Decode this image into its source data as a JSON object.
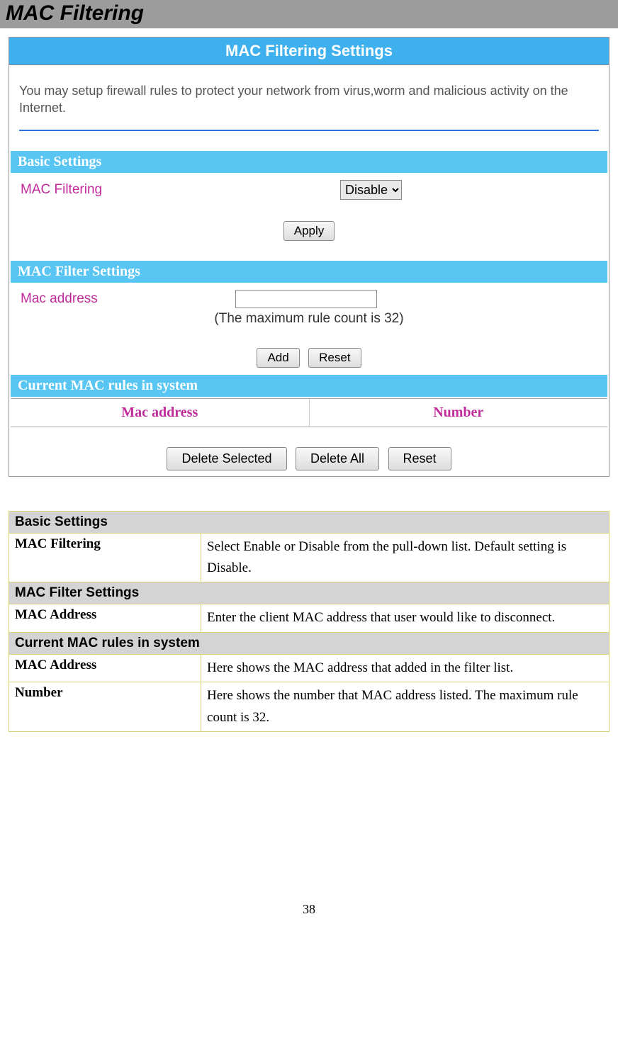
{
  "pageTitle": "MAC Filtering",
  "panel": {
    "headerTitle": "MAC Filtering Settings",
    "intro": "You may setup firewall rules to protect your network from virus,worm and malicious activity on the Internet.",
    "basicSection": {
      "title": "Basic Settings",
      "macFilteringLabel": "MAC Filtering",
      "selectValue": "Disable",
      "applyLabel": "Apply"
    },
    "filterSection": {
      "title": "MAC Filter Settings",
      "macAddressLabel": "Mac address",
      "macAddressValue": "",
      "note": "(The maximum rule count is 32)",
      "addLabel": "Add",
      "resetLabel": "Reset"
    },
    "rulesSection": {
      "title": "Current MAC rules in system",
      "colMac": "Mac address",
      "colNumber": "Number",
      "deleteSelectedLabel": "Delete Selected",
      "deleteAllLabel": "Delete All",
      "resetLabel": "Reset"
    }
  },
  "descTable": {
    "sections": [
      {
        "header": "Basic Settings",
        "rows": [
          {
            "key": "MAC Filtering",
            "val": "Select Enable or Disable from the pull-down list. Default setting is Disable."
          }
        ]
      },
      {
        "header": "MAC Filter Settings",
        "rows": [
          {
            "key": "MAC Address",
            "val": "Enter the client MAC address that user would like to disconnect."
          }
        ]
      },
      {
        "header": "Current MAC rules in system",
        "rows": [
          {
            "key": "MAC Address",
            "val": "Here shows the MAC address that added in the filter list."
          },
          {
            "key": "Number",
            "val": "Here shows the number that MAC address listed. The maximum rule count is 32."
          }
        ]
      }
    ]
  },
  "pageNumber": "38"
}
